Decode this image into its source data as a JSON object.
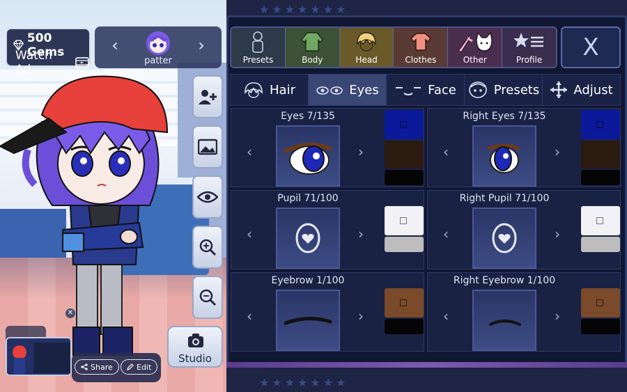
{
  "top_left": {
    "gems_label": "500 Gems",
    "watch_ad_label": "Watch Ad",
    "gem_icon": "gem-icon",
    "film_icon": "film-icon"
  },
  "character": {
    "name": "patter",
    "prev_icon": "chevron-left-icon",
    "next_icon": "chevron-right-icon"
  },
  "side_buttons": [
    "add-character-icon",
    "background-image-icon",
    "eye-icon",
    "zoom-in-icon",
    "zoom-out-icon"
  ],
  "studio": {
    "label": "Studio",
    "icon": "camera-icon"
  },
  "share": {
    "share_label": "Share",
    "edit_label": "Edit"
  },
  "categories": [
    {
      "label": "Presets",
      "color": "#2e3a4a"
    },
    {
      "label": "Body",
      "color": "#3d5136"
    },
    {
      "label": "Head",
      "color": "#6a5a2a"
    },
    {
      "label": "Clothes",
      "color": "#5a3a34"
    },
    {
      "label": "Other",
      "color": "#4a2e4e"
    },
    {
      "label": "Profile",
      "color": "#3a2e4e"
    }
  ],
  "close_label": "X",
  "sub_tabs": [
    {
      "label": "Hair",
      "active": false
    },
    {
      "label": "Eyes",
      "active": true
    },
    {
      "label": "Face",
      "active": false
    },
    {
      "label": "Presets",
      "active": false
    },
    {
      "label": "Adjust",
      "active": false
    }
  ],
  "cards": [
    {
      "title": "Eyes 7/135",
      "swatches": [
        "#0a1a9a",
        "#2a1a10",
        "#050505"
      ]
    },
    {
      "title": "Right Eyes 7/135",
      "swatches": [
        "#0a1a9a",
        "#2a1a10",
        "#050505"
      ]
    },
    {
      "title": "Pupil 71/100",
      "swatches": [
        "#f2f2f6",
        "#bdbdbd"
      ]
    },
    {
      "title": "Right Pupil 71/100",
      "swatches": [
        "#f2f2f6",
        "#bdbdbd"
      ]
    },
    {
      "title": "Eyebrow 1/100",
      "swatches": [
        "#7a4a2a",
        "#050505"
      ]
    },
    {
      "title": "Right Eyebrow 1/100",
      "swatches": [
        "#7a4a2a",
        "#050505"
      ]
    }
  ]
}
